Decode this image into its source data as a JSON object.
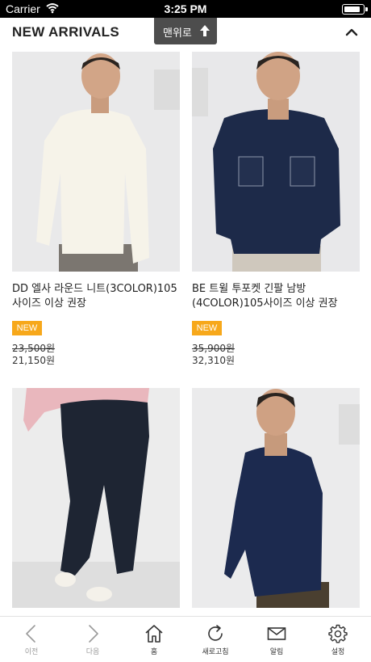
{
  "status_bar": {
    "carrier": "Carrier",
    "time": "3:25 PM",
    "battery_level": 0.9
  },
  "section": {
    "title": "NEW ARRIVALS",
    "scroll_top_label": "맨위로"
  },
  "products": [
    {
      "name": "DD 엘사 라운드 니트(3COLOR)105사이즈 이상 권장",
      "badge": "NEW",
      "price_original": "23,500원",
      "price_sale": "21,150원"
    },
    {
      "name": "BE 트윌 투포켓 긴팔 남방(4COLOR)105사이즈 이상 권장",
      "badge": "NEW",
      "price_original": "35,900원",
      "price_sale": "32,310원"
    },
    {
      "name": "",
      "badge": "",
      "price_original": "",
      "price_sale": ""
    },
    {
      "name": "",
      "badge": "",
      "price_original": "",
      "price_sale": ""
    }
  ],
  "tab_bar": {
    "items": [
      {
        "label": "이전",
        "icon": "chevron-left-icon",
        "enabled": false
      },
      {
        "label": "다음",
        "icon": "chevron-right-icon",
        "enabled": false
      },
      {
        "label": "홈",
        "icon": "home-icon",
        "enabled": true
      },
      {
        "label": "새로고침",
        "icon": "refresh-icon",
        "enabled": true
      },
      {
        "label": "알림",
        "icon": "mail-icon",
        "enabled": true
      },
      {
        "label": "설정",
        "icon": "gear-icon",
        "enabled": true
      }
    ]
  },
  "colors": {
    "badge": "#f7a81b",
    "scroll_top_bg": "#4d4d4d",
    "text": "#222222"
  }
}
